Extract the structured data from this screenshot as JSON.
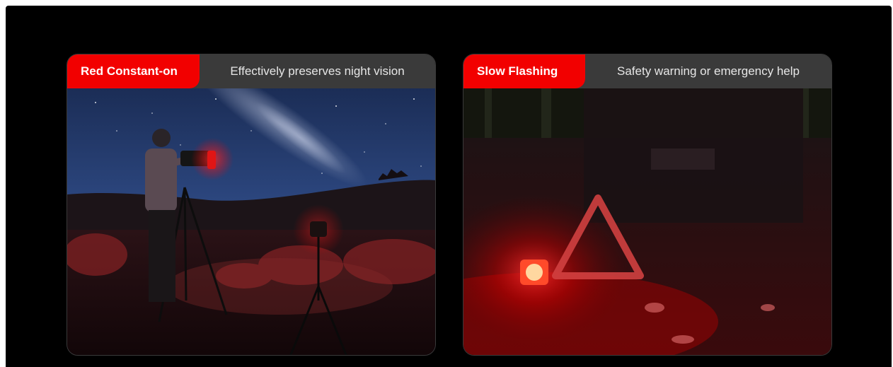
{
  "cards": [
    {
      "mode_label": "Red Constant-on",
      "description": "Effectively preserves night vision",
      "image": "astrophotographer-night-sky-red-light-photo"
    },
    {
      "mode_label": "Slow Flashing",
      "description": "Safety warning or emergency help",
      "image": "roadside-warning-triangle-red-flash-photo"
    }
  ],
  "colors": {
    "accent": "#f20000",
    "header_bg": "#3a3a3a",
    "page_bg": "#000000"
  }
}
